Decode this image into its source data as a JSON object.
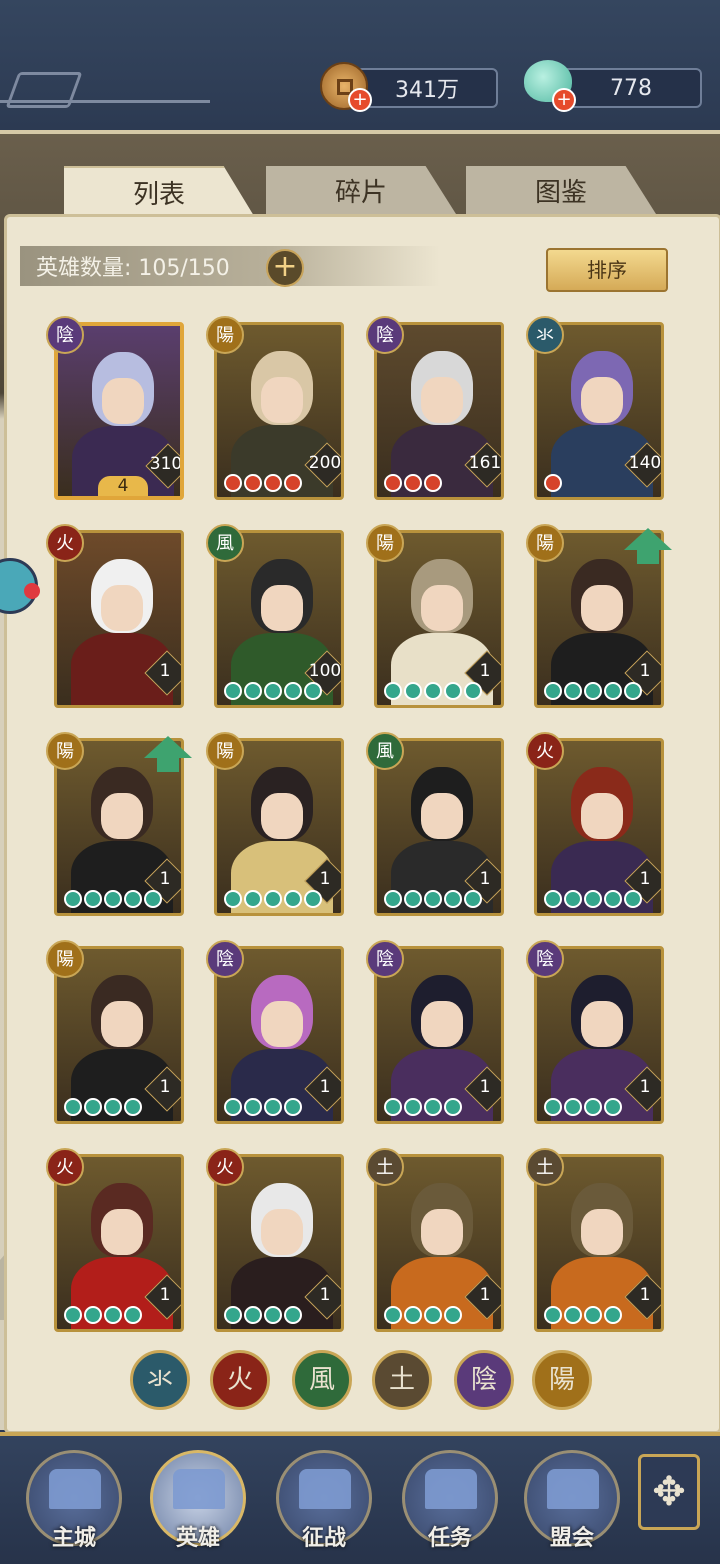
{
  "top": {
    "coins": "341万",
    "jade": "778"
  },
  "tabs": [
    "列表",
    "碎片",
    "图鉴"
  ],
  "hero_count": "英雄数量: 105/150",
  "sort_label": "排序",
  "elements": {
    "water": "氺",
    "fire": "火",
    "wind": "風",
    "earth": "土",
    "yin": "陰",
    "yang": "陽"
  },
  "colors": {
    "water": "#2b5a6a",
    "fire": "#8a2418",
    "wind": "#2f6a3a",
    "earth": "#5a4a32",
    "yin": "#5a3a7a",
    "yang": "#a0701a"
  },
  "heroes": [
    {
      "elem": "yin",
      "level": "310",
      "stars": "4",
      "gems": 0,
      "gem": "red",
      "hair": "#b7bde0",
      "body": "#3b2a52",
      "bg": "#5a3e6e",
      "gold": true
    },
    {
      "elem": "yang",
      "level": "200",
      "gems": 4,
      "gem": "red",
      "hair": "#d9c7a6",
      "body": "#3b3a2a",
      "bg": "#6e5a2e"
    },
    {
      "elem": "yin",
      "level": "161",
      "gems": 3,
      "gem": "red",
      "hair": "#d8d8d8",
      "body": "#3a2a3e",
      "bg": "#5e4a2e"
    },
    {
      "elem": "water",
      "level": "140",
      "gems": 1,
      "gem": "red",
      "hair": "#7d68b3",
      "body": "#2a3e5e",
      "bg": "#6e5a2e"
    },
    {
      "elem": "fire",
      "level": "1",
      "gems": 0,
      "gem": "red",
      "hair": "#f0f0f0",
      "body": "#6a1e1a",
      "bg": "#6e4a2a"
    },
    {
      "elem": "wind",
      "level": "100",
      "gems": 5,
      "gem": "jade",
      "hair": "#2a2a2a",
      "body": "#2f5a2a",
      "bg": "#6e5a2e"
    },
    {
      "elem": "yang",
      "level": "1",
      "gems": 5,
      "gem": "jade",
      "hair": "#a89a7e",
      "body": "#e8e0c8",
      "bg": "#6e5a2e"
    },
    {
      "elem": "yang",
      "level": "1",
      "gems": 5,
      "gem": "jade",
      "hair": "#3a2a22",
      "body": "#1e1e1e",
      "bg": "#6e5a2e",
      "up": true
    },
    {
      "elem": "yang",
      "level": "1",
      "gems": 5,
      "gem": "jade",
      "hair": "#3a2a22",
      "body": "#1e1e1e",
      "bg": "#6e5a2e",
      "up": true
    },
    {
      "elem": "yang",
      "level": "1",
      "gems": 5,
      "gem": "jade",
      "hair": "#2a2222",
      "body": "#d8c07a",
      "bg": "#6e5a2e"
    },
    {
      "elem": "wind",
      "level": "1",
      "gems": 5,
      "gem": "jade",
      "hair": "#1e1e1e",
      "body": "#2a2a2a",
      "bg": "#6e5a2e"
    },
    {
      "elem": "fire",
      "level": "1",
      "gems": 5,
      "gem": "jade",
      "hair": "#8a2a1a",
      "body": "#3a2a52",
      "bg": "#6e5a2e"
    },
    {
      "elem": "yang",
      "level": "1",
      "gems": 4,
      "gem": "jade",
      "hair": "#3a2a22",
      "body": "#1e1e1e",
      "bg": "#6e5a2e"
    },
    {
      "elem": "yin",
      "level": "1",
      "gems": 4,
      "gem": "jade",
      "hair": "#b86ac0",
      "body": "#2a2a4a",
      "bg": "#6e5a2e"
    },
    {
      "elem": "yin",
      "level": "1",
      "gems": 4,
      "gem": "jade",
      "hair": "#1e1e2e",
      "body": "#4a2e5e",
      "bg": "#6e5a2e"
    },
    {
      "elem": "yin",
      "level": "1",
      "gems": 4,
      "gem": "jade",
      "hair": "#1e1e2e",
      "body": "#4a2e5e",
      "bg": "#6e5a2e"
    },
    {
      "elem": "fire",
      "level": "1",
      "gems": 4,
      "gem": "jade",
      "hair": "#5a2a22",
      "body": "#b21e1a",
      "bg": "#6e5a2e"
    },
    {
      "elem": "fire",
      "level": "1",
      "gems": 4,
      "gem": "jade",
      "hair": "#e8e8e8",
      "body": "#2a1e1e",
      "bg": "#6e5a2e"
    },
    {
      "elem": "earth",
      "level": "1",
      "gems": 4,
      "gem": "jade",
      "hair": "#6a5a3a",
      "body": "#c86a1e",
      "bg": "#6e5a2e"
    },
    {
      "elem": "earth",
      "level": "1",
      "gems": 4,
      "gem": "jade",
      "hair": "#6a5a3a",
      "body": "#c86a1e",
      "bg": "#6e5a2e"
    }
  ],
  "filters": [
    "water",
    "fire",
    "wind",
    "earth",
    "yin",
    "yang"
  ],
  "nav": [
    "主城",
    "英雄",
    "征战",
    "任务",
    "盟会"
  ]
}
